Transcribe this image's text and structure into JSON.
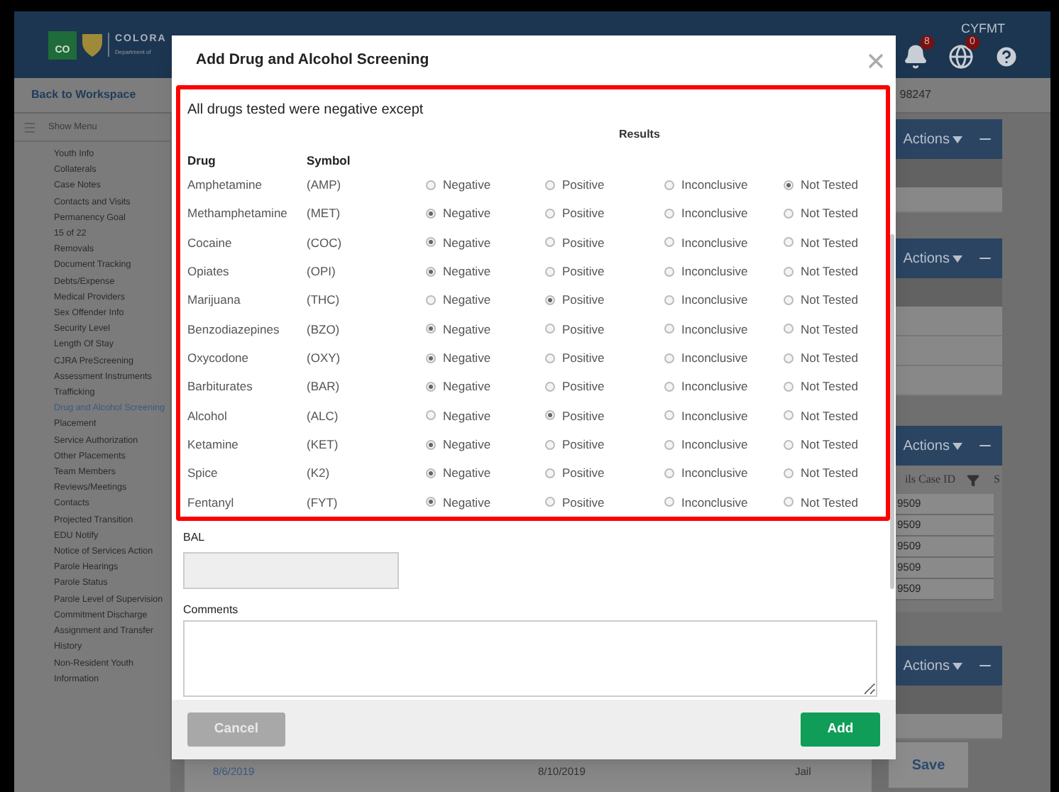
{
  "header": {
    "logo_mark": "CO",
    "logo_text": "COLORA",
    "logo_subtext": "Department of",
    "user": "CYFMT",
    "badges": [
      {
        "kind": "bell",
        "count": "8"
      },
      {
        "kind": "globe",
        "count": "0"
      }
    ]
  },
  "subbar": {
    "back_link": "Back to Workspace",
    "case_number": "98247"
  },
  "sidebar": {
    "toggle": "Show Menu",
    "items": [
      {
        "label": "Youth Info",
        "selected": false
      },
      {
        "label": "Collaterals",
        "selected": false
      },
      {
        "label": "Case Notes",
        "selected": false
      },
      {
        "label": "Contacts and Visits",
        "selected": false
      },
      {
        "label": "Permanency Goal",
        "selected": false
      },
      {
        "label": "15 of 22",
        "selected": false
      },
      {
        "label": "Removals",
        "selected": false
      },
      {
        "label": "Document Tracking",
        "selected": false
      },
      {
        "label": "Debts/Expense",
        "selected": false
      },
      {
        "label": "Medical Providers",
        "selected": false
      },
      {
        "label": "Sex Offender Info",
        "selected": false
      },
      {
        "label": "Security Level",
        "selected": false
      },
      {
        "label": "Length Of Stay",
        "selected": false
      },
      {
        "label": "CJRA PreScreening",
        "selected": false
      },
      {
        "label": "Assessment Instruments",
        "selected": false
      },
      {
        "label": "Trafficking",
        "selected": false
      },
      {
        "label": "Drug and Alcohol Screening",
        "selected": true
      },
      {
        "label": "Placement",
        "selected": false
      },
      {
        "label": "Service Authorization",
        "selected": false
      },
      {
        "label": "Other Placements",
        "selected": false
      },
      {
        "label": "Team Members",
        "selected": false
      },
      {
        "label": "Reviews/Meetings",
        "selected": false
      },
      {
        "label": "Contacts",
        "selected": false
      },
      {
        "label": "Projected Transition",
        "selected": false
      },
      {
        "label": "EDU Notify",
        "selected": false
      },
      {
        "label": "Notice of Services Action",
        "selected": false
      },
      {
        "label": "Parole Hearings",
        "selected": false
      },
      {
        "label": "Parole Status",
        "selected": false
      },
      {
        "label": "Parole Level of Supervision",
        "selected": false
      },
      {
        "label": "Commitment Discharge",
        "selected": false
      },
      {
        "label": "Assignment and Transfer History",
        "selected": false
      },
      {
        "label": "Non-Resident Youth Information",
        "selected": false
      }
    ]
  },
  "panels": [
    {
      "actions": "Actions",
      "kind": "plain"
    },
    {
      "actions": "Actions",
      "kind": "list"
    },
    {
      "actions": "Actions",
      "kind": "table"
    },
    {
      "actions": "Actions",
      "kind": "plain"
    }
  ],
  "case_table": {
    "column_1": "ils Case ID",
    "column_2": "S",
    "rows": [
      "9509",
      "9509",
      "9509",
      "9509",
      "9509"
    ]
  },
  "history_rows": [
    {
      "column_1": "8/6/2019",
      "column_2": "8/10/2019",
      "column_3": "Jail"
    }
  ],
  "save_button": "Save",
  "dialog": {
    "title": "Add Drug and Alcohol Screening",
    "heading": "All drugs tested were negative except",
    "results_label": "Results",
    "columns": [
      "Drug",
      "Symbol"
    ],
    "rows": [
      {
        "drug": "Amphetamine",
        "symbol": "(AMP)",
        "results": [
          {
            "label": "Negative",
            "selected": false
          },
          {
            "label": "Positive",
            "selected": false
          },
          {
            "label": "Inconclusive",
            "selected": false
          },
          {
            "label": "Not Tested",
            "selected": true
          }
        ]
      },
      {
        "drug": "Methamphetamine",
        "symbol": "(MET)",
        "results": [
          {
            "label": "Negative",
            "selected": true
          },
          {
            "label": "Positive",
            "selected": false
          },
          {
            "label": "Inconclusive",
            "selected": false
          },
          {
            "label": "Not Tested",
            "selected": false
          }
        ]
      },
      {
        "drug": "Cocaine",
        "symbol": "(COC)",
        "results": [
          {
            "label": "Negative",
            "selected": true
          },
          {
            "label": "Positive",
            "selected": false
          },
          {
            "label": "Inconclusive",
            "selected": false
          },
          {
            "label": "Not Tested",
            "selected": false
          }
        ]
      },
      {
        "drug": "Opiates",
        "symbol": "(OPI)",
        "results": [
          {
            "label": "Negative",
            "selected": true
          },
          {
            "label": "Positive",
            "selected": false
          },
          {
            "label": "Inconclusive",
            "selected": false
          },
          {
            "label": "Not Tested",
            "selected": false
          }
        ]
      },
      {
        "drug": "Marijuana",
        "symbol": "(THC)",
        "results": [
          {
            "label": "Negative",
            "selected": false
          },
          {
            "label": "Positive",
            "selected": true
          },
          {
            "label": "Inconclusive",
            "selected": false
          },
          {
            "label": "Not Tested",
            "selected": false
          }
        ]
      },
      {
        "drug": "Benzodiazepines",
        "symbol": "(BZO)",
        "results": [
          {
            "label": "Negative",
            "selected": true
          },
          {
            "label": "Positive",
            "selected": false
          },
          {
            "label": "Inconclusive",
            "selected": false
          },
          {
            "label": "Not Tested",
            "selected": false
          }
        ]
      },
      {
        "drug": "Oxycodone",
        "symbol": "(OXY)",
        "results": [
          {
            "label": "Negative",
            "selected": true
          },
          {
            "label": "Positive",
            "selected": false
          },
          {
            "label": "Inconclusive",
            "selected": false
          },
          {
            "label": "Not Tested",
            "selected": false
          }
        ]
      },
      {
        "drug": "Barbiturates",
        "symbol": "(BAR)",
        "results": [
          {
            "label": "Negative",
            "selected": true
          },
          {
            "label": "Positive",
            "selected": false
          },
          {
            "label": "Inconclusive",
            "selected": false
          },
          {
            "label": "Not Tested",
            "selected": false
          }
        ]
      },
      {
        "drug": "Alcohol",
        "symbol": "(ALC)",
        "results": [
          {
            "label": "Negative",
            "selected": false
          },
          {
            "label": "Positive",
            "selected": true
          },
          {
            "label": "Inconclusive",
            "selected": false
          },
          {
            "label": "Not Tested",
            "selected": false
          }
        ]
      },
      {
        "drug": "Ketamine",
        "symbol": "(KET)",
        "results": [
          {
            "label": "Negative",
            "selected": true
          },
          {
            "label": "Positive",
            "selected": false
          },
          {
            "label": "Inconclusive",
            "selected": false
          },
          {
            "label": "Not Tested",
            "selected": false
          }
        ]
      },
      {
        "drug": "Spice",
        "symbol": "(K2)",
        "results": [
          {
            "label": "Negative",
            "selected": true
          },
          {
            "label": "Positive",
            "selected": false
          },
          {
            "label": "Inconclusive",
            "selected": false
          },
          {
            "label": "Not Tested",
            "selected": false
          }
        ]
      },
      {
        "drug": "Fentanyl",
        "symbol": "(FYT)",
        "results": [
          {
            "label": "Negative",
            "selected": true
          },
          {
            "label": "Positive",
            "selected": false
          },
          {
            "label": "Inconclusive",
            "selected": false
          },
          {
            "label": "Not Tested",
            "selected": false
          }
        ]
      }
    ],
    "bal": {
      "label": "BAL"
    },
    "comments": {
      "label": "Comments"
    },
    "cancel": {
      "label": "Cancel",
      "disabled": true
    },
    "add": {
      "label": "Add"
    }
  }
}
